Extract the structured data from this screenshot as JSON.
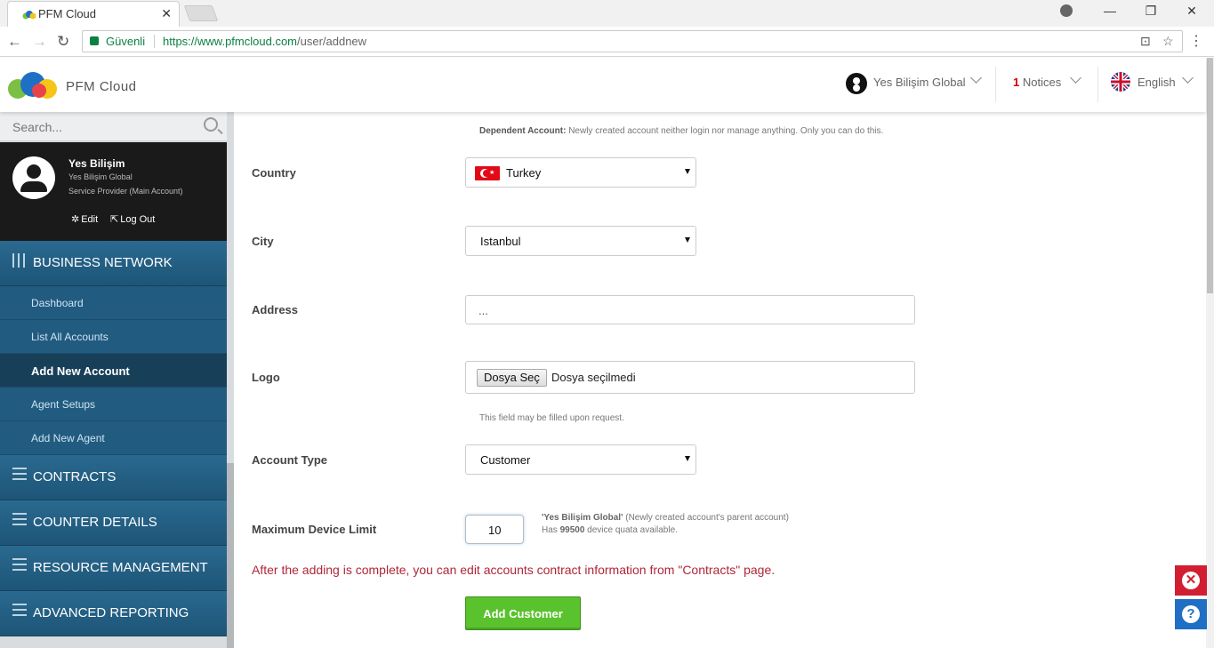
{
  "browser": {
    "tab_title": "PFM Cloud",
    "tab_close": "✕",
    "secure_label": "Güvenli",
    "url_scheme_host": "https://www.pfmcloud.com",
    "url_path": "/user/addnew",
    "back": "←",
    "forward": "→",
    "reload": "↻",
    "translate": "⊡",
    "star": "☆",
    "menu": "⋮",
    "minimize": "—",
    "restore": "❐",
    "close": "✕"
  },
  "header": {
    "brand": "PFM Cloud",
    "user_label": "Yes Bilişim Global",
    "notice_count": "1",
    "notice_label": "Notices",
    "language": "English"
  },
  "sidebar": {
    "search_placeholder": "Search...",
    "profile": {
      "name": "Yes Bilişim",
      "org": "Yes Bilişim Global",
      "role": "Service Provider (Main Account)",
      "edit": "Edit",
      "logout": "Log Out"
    },
    "sections": [
      {
        "label": "BUSINESS NETWORK"
      },
      {
        "label": "CONTRACTS"
      },
      {
        "label": "COUNTER DETAILS"
      },
      {
        "label": "RESOURCE MANAGEMENT"
      },
      {
        "label": "ADVANCED REPORTING"
      }
    ],
    "sub_items": [
      {
        "label": "Dashboard"
      },
      {
        "label": "List All Accounts"
      },
      {
        "label": "Add New Account"
      },
      {
        "label": "Agent Setups"
      },
      {
        "label": "Add New Agent"
      }
    ]
  },
  "form": {
    "dependent_title": "Dependent Account:",
    "dependent_desc": "Newly created account neither login nor manage anything. Only you can do this.",
    "country_label": "Country",
    "country_value": "Turkey",
    "city_label": "City",
    "city_value": "Istanbul",
    "address_label": "Address",
    "address_value": "...",
    "logo_label": "Logo",
    "file_button": "Dosya Seç",
    "file_status": "Dosya seçilmedi",
    "logo_hint": "This field may be filled upon request.",
    "account_type_label": "Account Type",
    "account_type_value": "Customer",
    "device_limit_label": "Maximum Device Limit",
    "device_limit_value": "10",
    "quota_parent_name": "'Yes Bilişim Global'",
    "quota_parent_desc": "(Newly created account's parent account)",
    "quota_has": "Has",
    "quota_amount": "99500",
    "quota_tail": "device quata available.",
    "contracts_notice": "After the adding is complete, you can edit accounts contract information from \"Contracts\" page.",
    "submit_label": "Add Customer"
  },
  "colors": {
    "sidebar_blue": "#215b80",
    "submit_green": "#5ac22d",
    "notice_red": "#b0263a"
  }
}
